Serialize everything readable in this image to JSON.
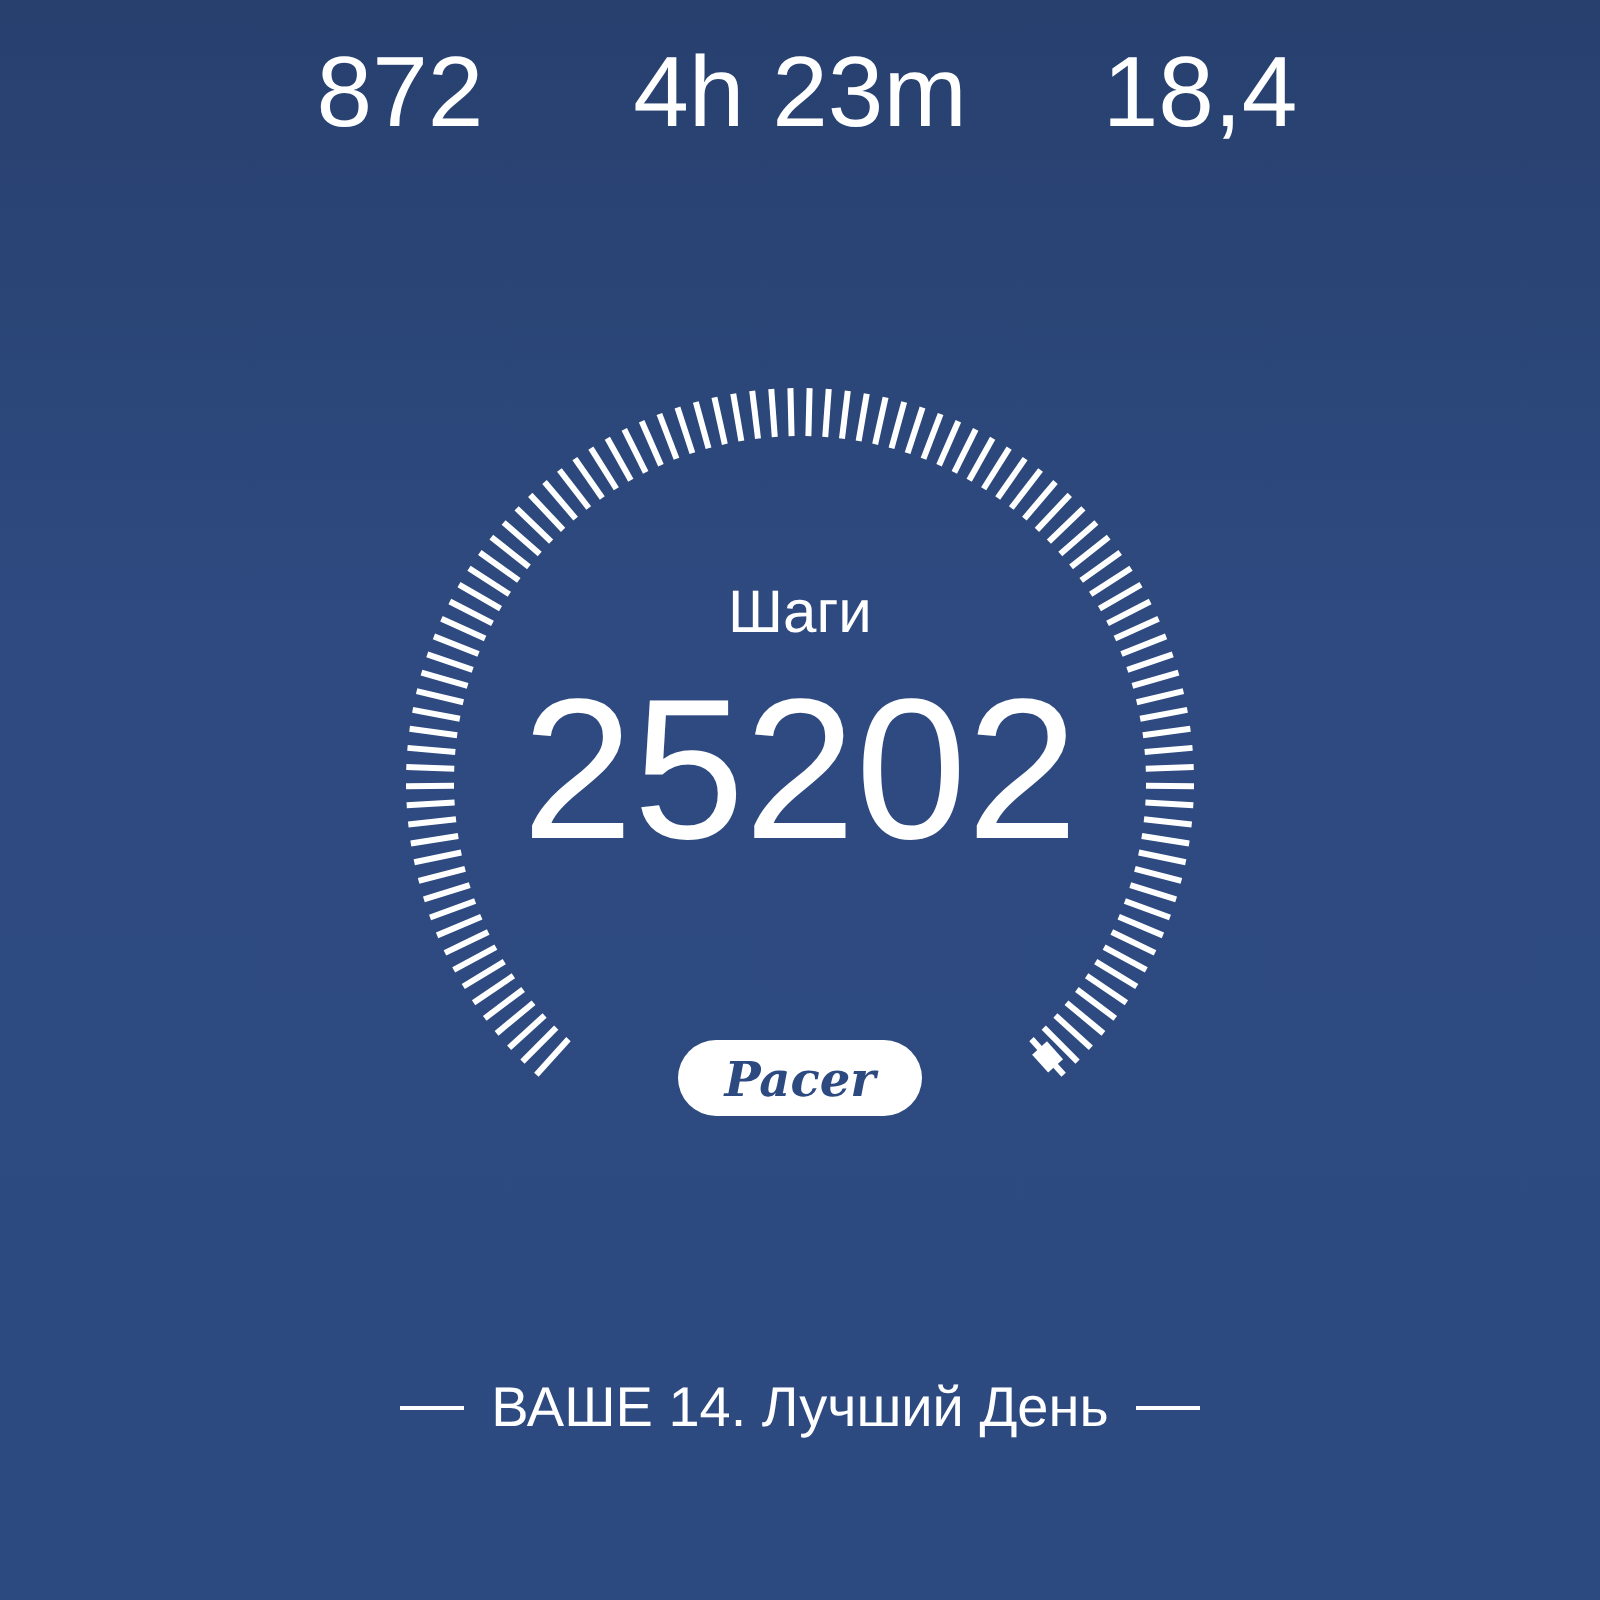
{
  "stats": [
    {
      "value": "872"
    },
    {
      "value": "4h 23m"
    },
    {
      "value": "18,4"
    }
  ],
  "gauge": {
    "label": "Шаги",
    "value": "25202",
    "logo": "Pacer"
  },
  "footer": {
    "text": "ВАШЕ 14. Лучший День"
  }
}
